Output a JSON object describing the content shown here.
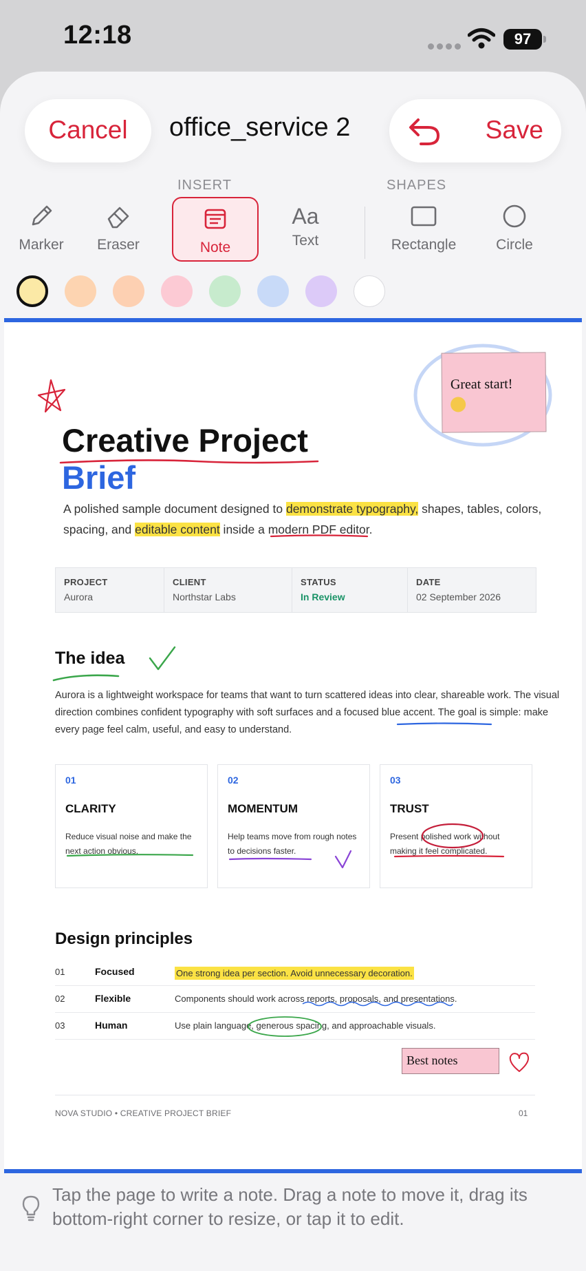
{
  "status_bar": {
    "time": "12:18",
    "battery": "97"
  },
  "header": {
    "cancel": "Cancel",
    "title": "office_service 2",
    "save": "Save"
  },
  "toolbar": {
    "insert_label": "INSERT",
    "shapes_label": "SHAPES",
    "tools": {
      "marker": "Marker",
      "eraser": "Eraser",
      "note": "Note",
      "text": "Text",
      "text_glyph": "Aa",
      "rectangle": "Rectangle",
      "circle": "Circle"
    },
    "active_tool": "note"
  },
  "colors": [
    "#fbe9a6",
    "#fdd4b1",
    "#fdd0b2",
    "#fccad4",
    "#c7ebcd",
    "#c8daf8",
    "#dccaf8",
    "#ffffff"
  ],
  "selected_color": "#fbe9a6",
  "document": {
    "title_line1": "Creative Project",
    "title_line2": "Brief",
    "intro": {
      "p1": "A polished sample document designed to ",
      "h1": "demonstrate typography,",
      "p2": " shapes, tables, colors, spacing, and ",
      "h2": "editable content",
      "p3": " inside a modern PDF editor."
    },
    "meta": [
      {
        "key": "PROJECT",
        "value": "Aurora"
      },
      {
        "key": "CLIENT",
        "value": "Northstar Labs"
      },
      {
        "key": "STATUS",
        "value": "In Review"
      },
      {
        "key": "DATE",
        "value": "02 September 2026"
      }
    ],
    "idea_heading": "The idea",
    "idea_body": "Aurora is a lightweight workspace for teams that want to turn scattered ideas into clear, shareable work. The visual direction combines confident typography with soft surfaces and a focused blue accent. The goal is simple: make every page feel calm, useful, and easy to understand.",
    "cards": [
      {
        "num": "01",
        "title": "CLARITY",
        "text": "Reduce visual noise and make the next action obvious."
      },
      {
        "num": "02",
        "title": "MOMENTUM",
        "text": "Help teams move from rough notes to decisions faster."
      },
      {
        "num": "03",
        "title": "TRUST",
        "text": "Present polished work without making it feel complicated."
      }
    ],
    "principles_heading": "Design principles",
    "principles": [
      {
        "num": "01",
        "name": "Focused",
        "desc": "One strong idea per section. Avoid unnecessary decoration."
      },
      {
        "num": "02",
        "name": "Flexible",
        "desc": "Components should work across reports, proposals, and presentations."
      },
      {
        "num": "03",
        "name": "Human",
        "desc": "Use plain language, generous spacing, and approachable visuals."
      }
    ],
    "footer_left": "NOVA STUDIO  •  CREATIVE PROJECT BRIEF",
    "footer_right": "01"
  },
  "annotations": {
    "sticky_note": "Great start!",
    "best_notes": "Best notes"
  },
  "hint": "Tap the page to write a note. Drag a note to move it, drag its bottom-right corner to resize, or tap it to edit."
}
